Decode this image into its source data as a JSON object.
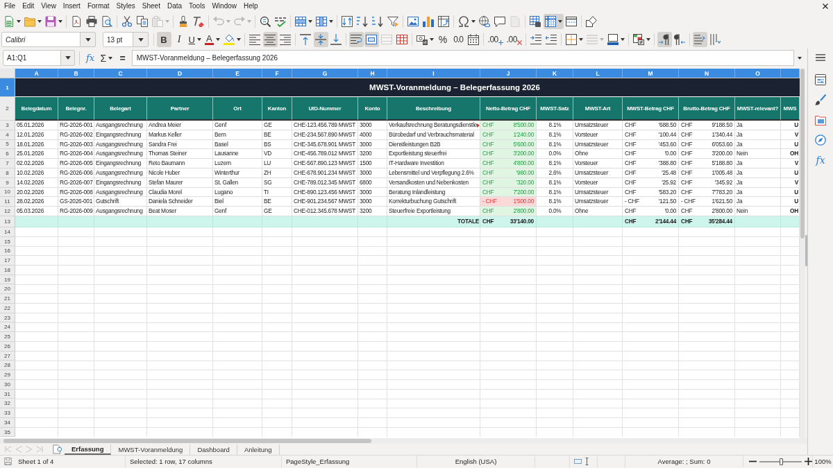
{
  "menu_bar": {
    "items": [
      "File",
      "Edit",
      "View",
      "Insert",
      "Format",
      "Styles",
      "Sheet",
      "Data",
      "Tools",
      "Window",
      "Help"
    ]
  },
  "standard_toolbar": {
    "paste_disabled": true,
    "undo_disabled": true,
    "redo_disabled": true,
    "header_footer_disabled": true,
    "freeze_pressed": true
  },
  "formatting_toolbar": {
    "font_name": "Calibri",
    "font_size": "13 pt",
    "bold": {
      "label": "B",
      "pressed": true
    },
    "italic": {
      "label": "I",
      "pressed": false
    },
    "underline": {
      "label": "U",
      "pressed": false
    },
    "font_color_label": "A",
    "align_left": false,
    "align_center": true,
    "align_right": false,
    "align_top": false,
    "align_middle": true,
    "align_bottom": false,
    "wrap_text": true,
    "merge_and_center": true,
    "merge_cells_disabled": true,
    "percent_label": "%",
    "number_label": "0.0",
    "add_decimal_label": ".00",
    "delete_decimal_label": ".00",
    "border_style_disabled": true,
    "left_to_right": true,
    "right_to_left": false,
    "text_horizontal": true,
    "text_vertical": false
  },
  "formula_bar": {
    "name_box": "A1:Q1",
    "function_wizard_label": "fx",
    "sum_label": "Σ",
    "formula_label": "=",
    "content": "MWST-Voranmeldung – Belegerfassung 2026"
  },
  "sheet": {
    "columns": [
      {
        "letter": "A",
        "selected": true
      },
      {
        "letter": "B",
        "selected": true
      },
      {
        "letter": "C",
        "selected": true
      },
      {
        "letter": "D",
        "selected": true
      },
      {
        "letter": "E",
        "selected": true
      },
      {
        "letter": "F",
        "selected": true
      },
      {
        "letter": "G",
        "selected": true
      },
      {
        "letter": "H",
        "selected": true
      },
      {
        "letter": "I",
        "selected": true
      },
      {
        "letter": "J",
        "selected": true
      },
      {
        "letter": "K",
        "selected": true
      },
      {
        "letter": "L",
        "selected": true
      },
      {
        "letter": "M",
        "selected": true
      },
      {
        "letter": "N",
        "selected": true
      },
      {
        "letter": "O",
        "selected": true
      },
      {
        "selected": true
      }
    ],
    "title_row": {
      "number": "1",
      "selected": true,
      "title": "MWST-Voranmeldung – Belegerfassung 2026"
    },
    "header_row": {
      "number": "2",
      "selected": false,
      "cells": [
        "Belegdatum",
        "Belegnr.",
        "Belegart",
        "Partner",
        "Ort",
        "Kanton",
        "UID-Nummer",
        "Konto",
        "Beschreibung",
        "Netto-Betrag CHF",
        "MWST-Satz",
        "MWST-Art",
        "MWST-Betrag CHF",
        "Brutto-Betrag CHF",
        "MWST-relevant?",
        "MWS"
      ]
    },
    "rows": [
      {
        "number": "3",
        "selected": false,
        "belegdatum": "05.01.2026",
        "belegnr": "RG-2026-001",
        "belegart": "Ausgangsrechnung",
        "partner": "Andrea Meier",
        "ort": "Genf",
        "kanton": "GE",
        "uid": "CHE-123.456.789 MWST",
        "konto": "3000",
        "beschreibung": "Verkaufsrechnung Beratungsdienstle",
        "beschreibung_overflow": true,
        "netto": {
          "currency": "CHF",
          "amount": "8'500.00",
          "negative": false
        },
        "mwst_satz": "8.1%",
        "mwst_art": "Umsatzsteuer",
        "mwst_betrag": {
          "currency": "CHF",
          "amount": "'688.50"
        },
        "brutto": {
          "currency": "CHF",
          "amount": "9'188.50"
        },
        "mwst_relevant": "Ja",
        "column_16": "U"
      },
      {
        "number": "4",
        "selected": false,
        "belegdatum": "12.01.2026",
        "belegnr": "RG-2026-002",
        "belegart": "Eingangsrechnung",
        "partner": "Markus Keller",
        "ort": "Bern",
        "kanton": "BE",
        "uid": "CHE-234.567.890 MWST",
        "konto": "4000",
        "beschreibung": "Bürobedarf und Verbrauchsmaterial",
        "beschreibung_overflow": false,
        "netto": {
          "currency": "CHF",
          "amount": "1'240.00",
          "negative": false
        },
        "mwst_satz": "8.1%",
        "mwst_art": "Vorsteuer",
        "mwst_betrag": {
          "currency": "CHF",
          "amount": "'100.44"
        },
        "brutto": {
          "currency": "CHF",
          "amount": "1'340.44"
        },
        "mwst_relevant": "Ja",
        "column_16": "V"
      },
      {
        "number": "5",
        "selected": false,
        "belegdatum": "18.01.2026",
        "belegnr": "RG-2026-003",
        "belegart": "Ausgangsrechnung",
        "partner": "Sandra Frei",
        "ort": "Basel",
        "kanton": "BS",
        "uid": "CHE-345.678.901 MWST",
        "konto": "3000",
        "beschreibung": "Dienstleistungen B2B",
        "beschreibung_overflow": false,
        "netto": {
          "currency": "CHF",
          "amount": "5'600.00",
          "negative": false
        },
        "mwst_satz": "8.1%",
        "mwst_art": "Umsatzsteuer",
        "mwst_betrag": {
          "currency": "CHF",
          "amount": "'453.60"
        },
        "brutto": {
          "currency": "CHF",
          "amount": "6'053.60"
        },
        "mwst_relevant": "Ja",
        "column_16": "U"
      },
      {
        "number": "6",
        "selected": false,
        "belegdatum": "25.01.2026",
        "belegnr": "RG-2026-004",
        "belegart": "Ausgangsrechnung",
        "partner": "Thomas Steiner",
        "ort": "Lausanne",
        "kanton": "VD",
        "uid": "CHE-456.789.012 MWST",
        "konto": "3200",
        "beschreibung": "Exportleistung steuerfrei",
        "beschreibung_overflow": false,
        "netto": {
          "currency": "CHF",
          "amount": "3'200.00",
          "negative": false
        },
        "mwst_satz": "0.0%",
        "mwst_art": "Ohne",
        "mwst_betrag": {
          "currency": "CHF",
          "amount": "'0.00"
        },
        "brutto": {
          "currency": "CHF",
          "amount": "3'200.00"
        },
        "mwst_relevant": "Nein",
        "column_16": "OH"
      },
      {
        "number": "7",
        "selected": false,
        "belegdatum": "02.02.2026",
        "belegnr": "RG-2026-005",
        "belegart": "Eingangsrechnung",
        "partner": "Reto Baumann",
        "ort": "Luzern",
        "kanton": "LU",
        "uid": "CHE-567.890.123 MWST",
        "konto": "1500",
        "beschreibung": "IT-Hardware Investition",
        "beschreibung_overflow": false,
        "netto": {
          "currency": "CHF",
          "amount": "4'800.00",
          "negative": false
        },
        "mwst_satz": "8.1%",
        "mwst_art": "Vorsteuer",
        "mwst_betrag": {
          "currency": "CHF",
          "amount": "'388.80"
        },
        "brutto": {
          "currency": "CHF",
          "amount": "5'188.80"
        },
        "mwst_relevant": "Ja",
        "column_16": "V"
      },
      {
        "number": "8",
        "selected": false,
        "belegdatum": "10.02.2026",
        "belegnr": "RG-2026-006",
        "belegart": "Ausgangsrechnung",
        "partner": "Nicole Huber",
        "ort": "Winterthur",
        "kanton": "ZH",
        "uid": "CHE-678.901.234 MWST",
        "konto": "3000",
        "beschreibung": "Lebensmittel und Verpflegung 2.6%",
        "beschreibung_overflow": false,
        "netto": {
          "currency": "CHF",
          "amount": "'980.00",
          "negative": false
        },
        "mwst_satz": "2.6%",
        "mwst_art": "Umsatzsteuer",
        "mwst_betrag": {
          "currency": "CHF",
          "amount": "'25.48"
        },
        "brutto": {
          "currency": "CHF",
          "amount": "1'005.48"
        },
        "mwst_relevant": "Ja",
        "column_16": "U"
      },
      {
        "number": "9",
        "selected": false,
        "belegdatum": "14.02.2026",
        "belegnr": "RG-2026-007",
        "belegart": "Eingangsrechnung",
        "partner": "Stefan Maurer",
        "ort": "St. Gallen",
        "kanton": "SG",
        "uid": "CHE-789.012.345 MWST",
        "konto": "6800",
        "beschreibung": "Versandkosten und Nebenkosten",
        "beschreibung_overflow": false,
        "netto": {
          "currency": "CHF",
          "amount": "'320.00",
          "negative": false
        },
        "mwst_satz": "8.1%",
        "mwst_art": "Vorsteuer",
        "mwst_betrag": {
          "currency": "CHF",
          "amount": "'25.92"
        },
        "brutto": {
          "currency": "CHF",
          "amount": "'345.92"
        },
        "mwst_relevant": "Ja",
        "column_16": "V"
      },
      {
        "number": "10",
        "selected": false,
        "belegdatum": "20.02.2026",
        "belegnr": "RG-2026-008",
        "belegart": "Ausgangsrechnung",
        "partner": "Claudia Morel",
        "ort": "Lugano",
        "kanton": "TI",
        "uid": "CHE-890.123.456 MWST",
        "konto": "3000",
        "beschreibung": "Beratung Inlandleistung",
        "beschreibung_overflow": false,
        "netto": {
          "currency": "CHF",
          "amount": "7'200.00",
          "negative": false
        },
        "mwst_satz": "8.1%",
        "mwst_art": "Umsatzsteuer",
        "mwst_betrag": {
          "currency": "CHF",
          "amount": "'583.20"
        },
        "brutto": {
          "currency": "CHF",
          "amount": "7'783.20"
        },
        "mwst_relevant": "Ja",
        "column_16": "U"
      },
      {
        "number": "11",
        "selected": false,
        "belegdatum": "28.02.2026",
        "belegnr": "GS-2026-001",
        "belegart": "Gutschrift",
        "partner": "Daniela Schneider",
        "ort": "Biel",
        "kanton": "BE",
        "uid": "CHE-901.234.567 MWST",
        "konto": "3000",
        "beschreibung": "Korrekturbuchung Gutschrift",
        "beschreibung_overflow": false,
        "netto": {
          "currency": "- CHF",
          "amount": "1'500.00",
          "negative": true
        },
        "mwst_satz": "8.1%",
        "mwst_art": "Umsatzsteuer",
        "mwst_betrag": {
          "currency": "- CHF",
          "amount": "'121.50"
        },
        "brutto": {
          "currency": "- CHF",
          "amount": "1'621.50"
        },
        "mwst_relevant": "Ja",
        "column_16": "U"
      },
      {
        "number": "12",
        "selected": false,
        "belegdatum": "05.03.2026",
        "belegnr": "RG-2026-009",
        "belegart": "Ausgangsrechnung",
        "partner": "Beat Moser",
        "ort": "Genf",
        "kanton": "GE",
        "uid": "CHE-012.345.678 MWST",
        "konto": "3200",
        "beschreibung": "Steuerfreie Exportleistung",
        "beschreibung_overflow": false,
        "netto": {
          "currency": "CHF",
          "amount": "2'800.00",
          "negative": false
        },
        "mwst_satz": "0.0%",
        "mwst_art": "Ohne",
        "mwst_betrag": {
          "currency": "CHF",
          "amount": "'0.00"
        },
        "brutto": {
          "currency": "CHF",
          "amount": "2'800.00"
        },
        "mwst_relevant": "Nein",
        "column_16": "OH"
      }
    ],
    "totals_row": {
      "number": "13",
      "selected": false,
      "label": "TOTALE",
      "netto": {
        "currency": "CHF",
        "amount": "33'140.00"
      },
      "mwst_betrag": {
        "currency": "CHF",
        "amount": "2'144.44"
      },
      "brutto": {
        "currency": "CHF",
        "amount": "35'284.44"
      }
    },
    "empty_rows": [
      {
        "number": "14",
        "selected": false
      },
      {
        "number": "15",
        "selected": false
      },
      {
        "number": "16",
        "selected": false
      },
      {
        "number": "17",
        "selected": false
      },
      {
        "number": "18",
        "selected": false
      },
      {
        "number": "19",
        "selected": false
      },
      {
        "number": "20",
        "selected": false
      },
      {
        "number": "21",
        "selected": false
      },
      {
        "number": "22",
        "selected": false
      },
      {
        "number": "23",
        "selected": false
      },
      {
        "number": "24",
        "selected": false
      },
      {
        "number": "25",
        "selected": false
      },
      {
        "number": "26",
        "selected": false
      },
      {
        "number": "27",
        "selected": false
      },
      {
        "number": "28",
        "selected": false
      },
      {
        "number": "29",
        "selected": false
      },
      {
        "number": "30",
        "selected": false
      },
      {
        "number": "31",
        "selected": false
      },
      {
        "number": "32",
        "selected": false
      },
      {
        "number": "33",
        "selected": false
      },
      {
        "number": "34",
        "selected": false
      },
      {
        "number": "35",
        "selected": false
      }
    ]
  },
  "sidebar": {
    "functions_label": "fx"
  },
  "sheet_navigation": {
    "disabled": true
  },
  "sheet_tabs": [
    {
      "label": "Erfassung",
      "selected": true
    },
    {
      "label": "MWST-Voranmeldung",
      "selected": false
    },
    {
      "label": "Dashboard",
      "selected": false
    },
    {
      "label": "Anleitung",
      "selected": false
    }
  ],
  "status_bar": {
    "sheet": "Sheet 1 of 4",
    "selection": "Selected: 1 row, 17 columns",
    "page_style": "PageStyle_Erfassung",
    "language": "English (USA)",
    "summary": "Average: ; Sum: 0",
    "zoom": {
      "level": 0.5,
      "label": "100%"
    }
  }
}
